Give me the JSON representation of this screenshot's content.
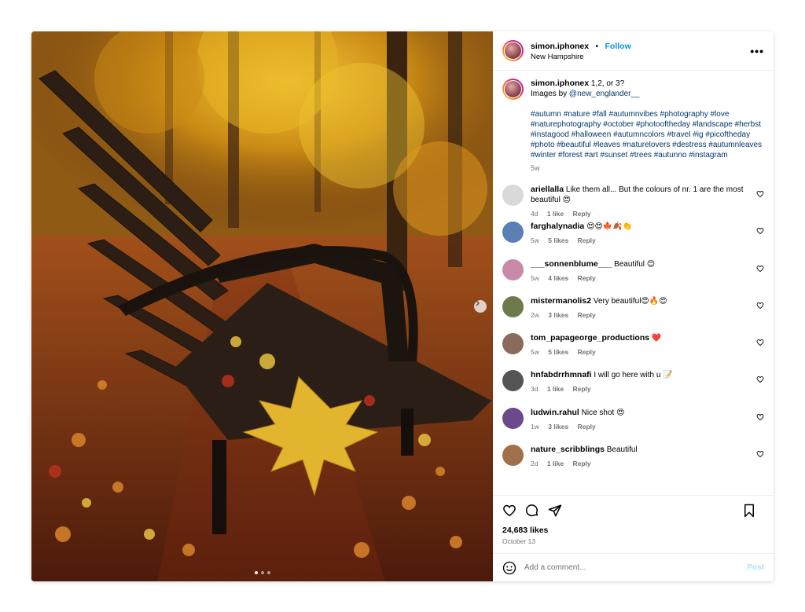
{
  "header": {
    "username": "simon.iphonex",
    "separator": "•",
    "follow_label": "Follow",
    "location": "New Hampshire",
    "more_label": "•••"
  },
  "caption": {
    "username": "simon.iphonex",
    "text": "1,2, or 3?",
    "credit_prefix": "Images by ",
    "credit_mention": "@new_englander__",
    "hashtags": "#autumn #nature #fall #autumnvibes #photography #love #naturephotography #october #photooftheday #landscape #herbst #instagood #halloween #autumncolors #travel #ig #picoftheday #photo #beautiful #leaves #naturelovers #destress #autumnleaves #winter #forest #art #sunset #trees #autunno #instagram",
    "time": "5w"
  },
  "comments": [
    {
      "user": "ariellalla",
      "text": "Like them all... But the colours of nr. 1 are the most beautiful 😍",
      "time": "4d",
      "likes": "1 like",
      "reply": "Reply",
      "avatar_color": "#d9d9d9"
    },
    {
      "user": "farghalynadia",
      "text": "😍😍🍁🍂👏",
      "time": "5w",
      "likes": "5 likes",
      "reply": "Reply",
      "avatar_color": "#5a7fb5"
    },
    {
      "user": "___sonnenblume___",
      "text": "Beautiful 😊",
      "time": "5w",
      "likes": "4 likes",
      "reply": "Reply",
      "avatar_color": "#c98aa8"
    },
    {
      "user": "mistermanolis2",
      "text": "Very beautiful😍🔥😍",
      "time": "2w",
      "likes": "3 likes",
      "reply": "Reply",
      "avatar_color": "#6f7a4a"
    },
    {
      "user": "tom_papageorge_productions",
      "text": "❤️",
      "time": "5w",
      "likes": "5 likes",
      "reply": "Reply",
      "avatar_color": "#8a6a5a"
    },
    {
      "user": "hnfabdrrhmnafi",
      "text": "I will go here with u 📝",
      "time": "3d",
      "likes": "1 like",
      "reply": "Reply",
      "avatar_color": "#555555"
    },
    {
      "user": "ludwin.rahul",
      "text": "Nice shot 😍",
      "time": "1w",
      "likes": "3 likes",
      "reply": "Reply",
      "avatar_color": "#6a4a8a"
    },
    {
      "user": "nature_scribblings",
      "text": "Beautiful",
      "time": "2d",
      "likes": "1 like",
      "reply": "Reply",
      "avatar_color": "#a0704a"
    }
  ],
  "actions": {
    "like_count": "24,683 likes",
    "date": "October 13"
  },
  "add_comment": {
    "placeholder": "Add a comment...",
    "post_label": "Post"
  },
  "carousel": {
    "slides": 3,
    "active": 0
  },
  "colors": {
    "accent": "#0095f6",
    "hashtag": "#00376b",
    "muted": "#737373"
  }
}
